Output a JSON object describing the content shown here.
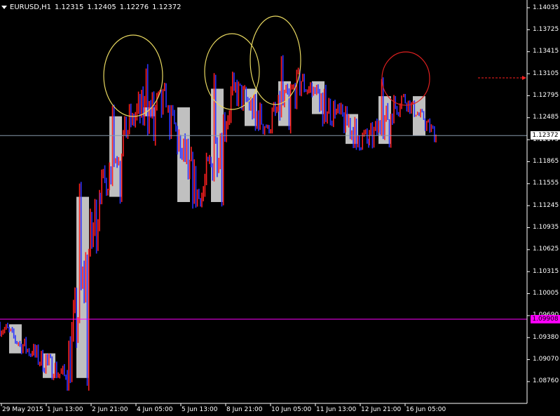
{
  "window": {
    "symbol": "EURUSD,H1",
    "open": "1.12315",
    "high": "1.12405",
    "low": "1.12276",
    "close": "1.12372"
  },
  "price_axis": {
    "labels": [
      "1.14035",
      "1.13725",
      "1.13415",
      "1.13105",
      "1.12795",
      "1.12485",
      "1.12175",
      "1.11865",
      "1.11555",
      "1.11245",
      "1.10935",
      "1.10625",
      "1.10315",
      "1.10005",
      "1.09690",
      "1.09380",
      "1.09070",
      "1.08760"
    ]
  },
  "time_axis": {
    "labels": [
      "29 May 2015",
      "1 Jun 13:00",
      "2 Jun 21:00",
      "4 Jun 05:00",
      "5 Jun 13:00",
      "8 Jun 21:00",
      "10 Jun 05:00",
      "11 Jun 13:00",
      "12 Jun 21:00",
      "16 Jun 05:00"
    ]
  },
  "current_price": {
    "label": "1.12372",
    "value": 1.12372,
    "color": "#ffffff"
  },
  "level_line": {
    "label": "1.09908",
    "value": 1.09908,
    "color": "#ff00ff"
  },
  "colors": {
    "background": "#000000",
    "bull": "#ff2020",
    "bear": "#2a32ff",
    "daily_box": "#c0c0c0",
    "circle_yellow": "#e8d860",
    "circle_red": "#e02020",
    "price_line": "#8899aa",
    "arrow": "#ff2020"
  },
  "chart_data": {
    "type": "candlestick-overlay",
    "ylim": [
      1.0861,
      1.1419
    ],
    "days": [
      {
        "o": 1.0984,
        "h": 1.1005,
        "l": 1.093,
        "c": 1.0945
      },
      {
        "o": 1.0945,
        "h": 1.0975,
        "l": 1.0885,
        "c": 1.0912
      },
      {
        "o": 1.0912,
        "h": 1.1175,
        "l": 1.0895,
        "c": 1.1155
      },
      {
        "o": 1.1155,
        "h": 1.1285,
        "l": 1.1145,
        "c": 1.1263
      },
      {
        "o": 1.1263,
        "h": 1.1375,
        "l": 1.12,
        "c": 1.1275
      },
      {
        "o": 1.1275,
        "h": 1.1278,
        "l": 1.1085,
        "c": 1.1148
      },
      {
        "o": 1.1148,
        "h": 1.1335,
        "l": 1.114,
        "c": 1.13
      },
      {
        "o": 1.13,
        "h": 1.1318,
        "l": 1.1195,
        "c": 1.125
      },
      {
        "o": 1.125,
        "h": 1.137,
        "l": 1.124,
        "c": 1.131
      },
      {
        "o": 1.131,
        "h": 1.132,
        "l": 1.1198,
        "c": 1.1266
      },
      {
        "o": 1.1266,
        "h": 1.1295,
        "l": 1.1178,
        "c": 1.1226
      },
      {
        "o": 1.1226,
        "h": 1.133,
        "l": 1.122,
        "c": 1.129
      },
      {
        "o": 1.129,
        "h": 1.1293,
        "l": 1.1228,
        "c": 1.1237
      }
    ],
    "highlights": [
      {
        "shape": "circle",
        "color": "yellow",
        "day": 4
      },
      {
        "shape": "circle",
        "color": "yellow",
        "day": 6
      },
      {
        "shape": "circle",
        "color": "yellow",
        "day": 8
      },
      {
        "shape": "circle",
        "color": "red",
        "day": 12
      }
    ]
  }
}
